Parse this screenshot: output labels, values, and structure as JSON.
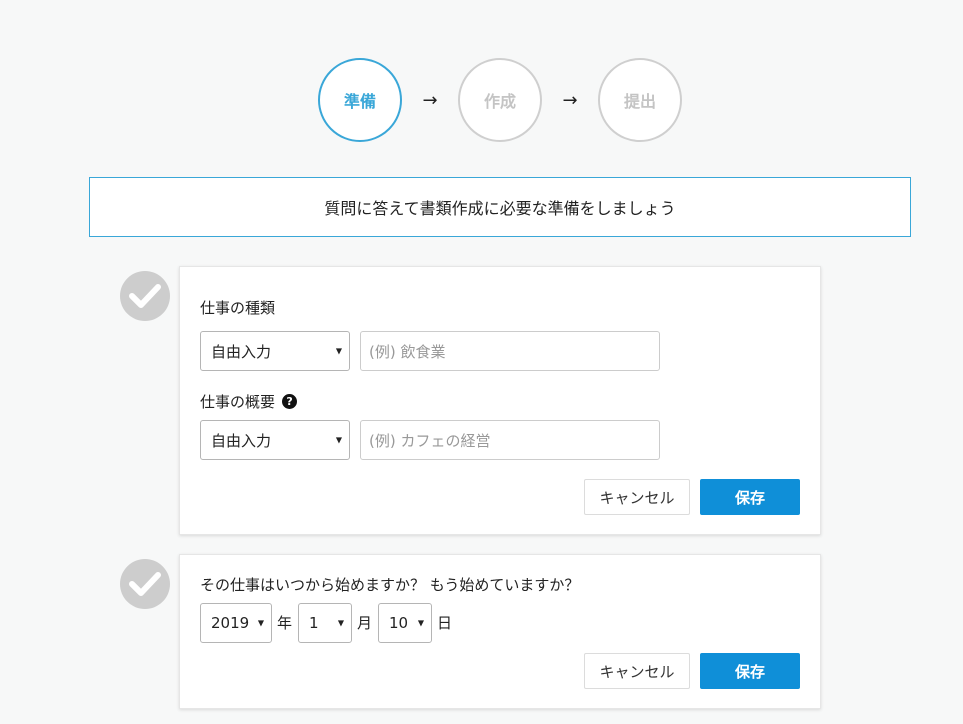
{
  "stepper": {
    "steps": [
      {
        "label": "準備",
        "state": "active"
      },
      {
        "label": "作成",
        "state": "inactive"
      },
      {
        "label": "提出",
        "state": "inactive"
      }
    ],
    "arrow": "→"
  },
  "banner": {
    "text": "質問に答えて書類作成に必要な準備をしましょう"
  },
  "card1": {
    "job_type": {
      "label": "仕事の種類",
      "mode_value": "自由入力",
      "placeholder": "(例) 飲食業"
    },
    "job_summary": {
      "label": "仕事の概要",
      "help_icon": "?",
      "mode_value": "自由入力",
      "placeholder": "(例) カフェの経営"
    },
    "cancel_label": "キャンセル",
    "save_label": "保存"
  },
  "card2": {
    "question": "その仕事はいつから始めますか？ もう始めていますか？",
    "year_value": "2019",
    "year_unit": "年",
    "month_value": "1",
    "month_unit": "月",
    "day_value": "10",
    "day_unit": "日",
    "cancel_label": "キャンセル",
    "save_label": "保存"
  },
  "colors": {
    "accent": "#3aa7d8",
    "primary_button": "#0f8fd8",
    "inactive_step": "#cfcfcf",
    "check_circle": "#cdcdcd"
  },
  "icons": {
    "check": "checkmark-icon",
    "dropdown": "caret-down-icon",
    "help": "question-circle-icon"
  }
}
